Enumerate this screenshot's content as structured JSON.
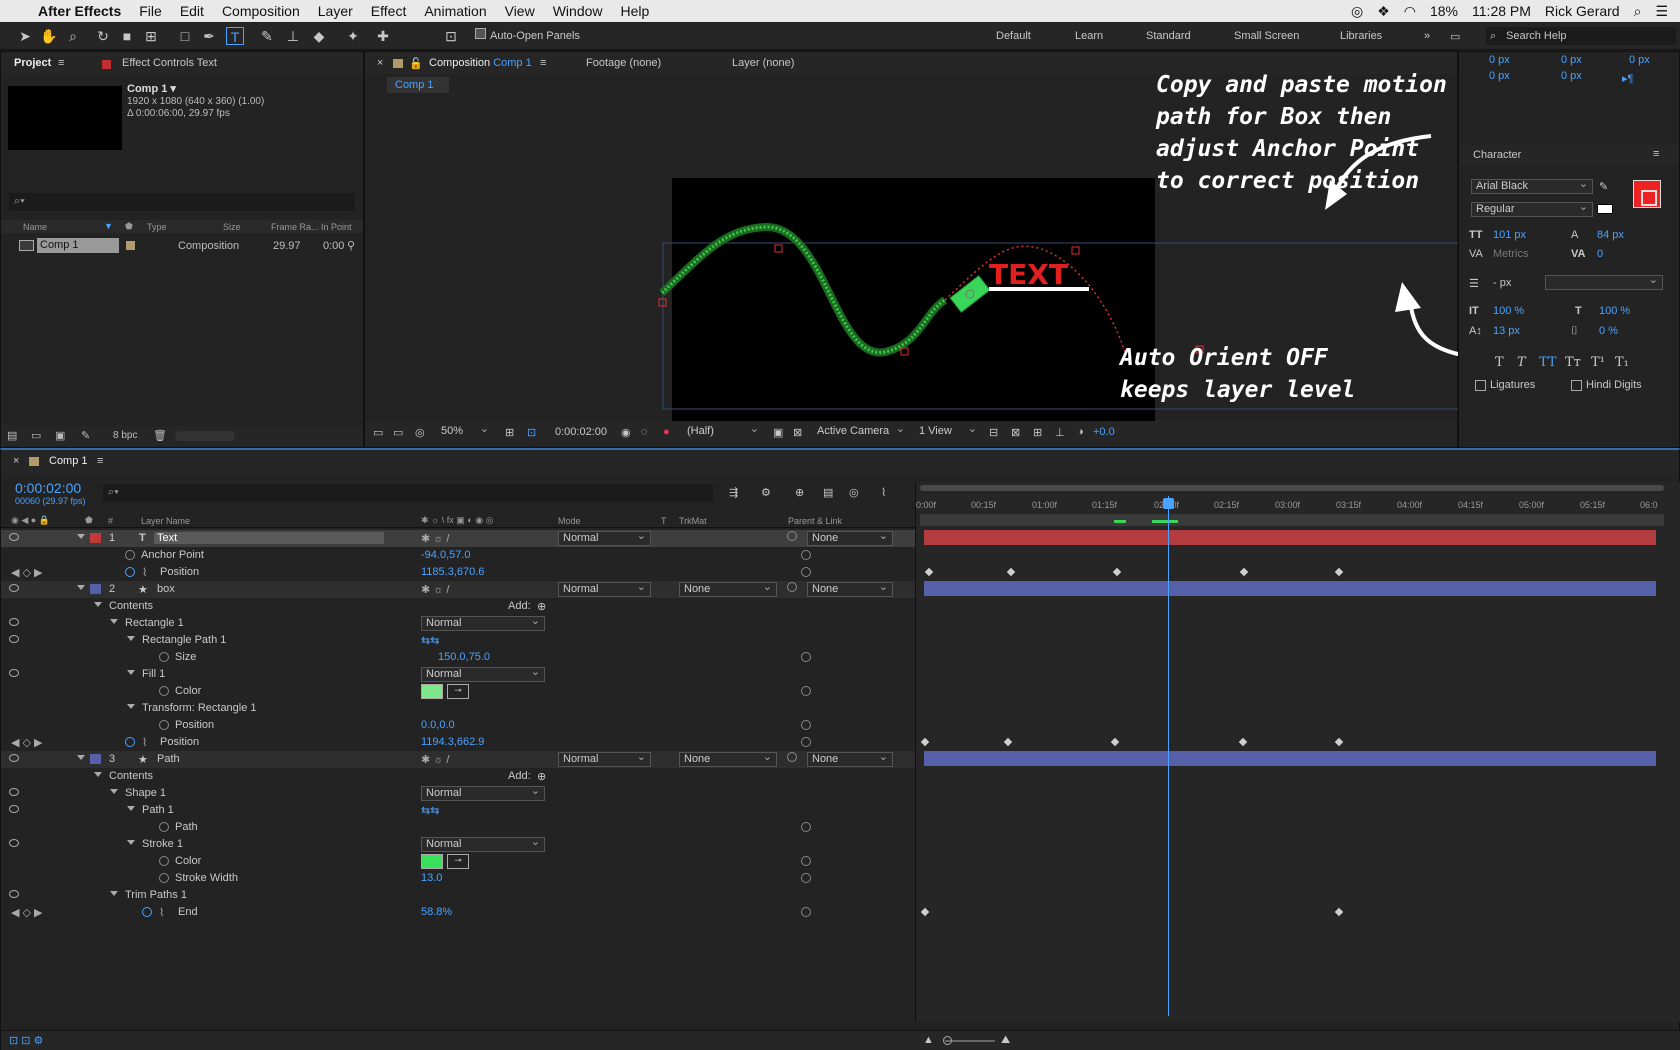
{
  "menubar": {
    "app": "After Effects",
    "items": [
      "File",
      "Edit",
      "Composition",
      "Layer",
      "Effect",
      "Animation",
      "View",
      "Window",
      "Help"
    ],
    "battery": "18%",
    "time": "11:28 PM",
    "user": "Rick Gerard"
  },
  "toolbar": {
    "auto_open": "Auto-Open Panels",
    "workspaces": [
      "Default",
      "Learn",
      "Standard",
      "Small Screen",
      "Libraries"
    ],
    "search": "Search Help"
  },
  "project": {
    "tab": "Project",
    "tab2": "Effect Controls Text",
    "comp_name": "Comp 1 ▾",
    "comp_info1": "1920 x 1080  (640 x 360) (1.00)",
    "comp_info2": "Δ 0:00:06:00, 29.97 fps",
    "cols": [
      "Name",
      "Type",
      "Size",
      "Frame Ra...",
      "In Point"
    ],
    "item": {
      "name": "Comp 1",
      "type": "Composition",
      "fps": "29.97",
      "in": "0:00"
    },
    "bpc": "8 bpc"
  },
  "viewer": {
    "tab_prefix": "Composition",
    "tab_comp": "Comp 1",
    "footage": "Footage (none)",
    "layer": "Layer (none)",
    "crumb": "Comp 1",
    "zoom": "50%",
    "time": "0:00:02:00",
    "res": "(Half)",
    "camera": "Active Camera",
    "view": "1 View",
    "exposure": "+0.0",
    "text_obj": "TEXT"
  },
  "annotations": {
    "top": "Copy and paste motion\npath for Box then\nadjust Anchor Point\nto correct position",
    "bottom": "Auto Orient OFF\nkeeps layer level"
  },
  "character": {
    "title": "Character",
    "font": "Arial Black",
    "style": "Regular",
    "size": "101 px",
    "leading": "84 px",
    "kerning": "Metrics",
    "tracking": "0",
    "stroke": "- px",
    "vscale": "100 %",
    "hscale": "100 %",
    "baseline": "13 px",
    "tsume": "0 %",
    "ligatures": "Ligatures",
    "hindi": "Hindi Digits",
    "top_vals": [
      "0 px",
      "0 px",
      "0 px",
      "0 px",
      "0 px"
    ],
    "fill_color": "#ee2222"
  },
  "timeline": {
    "tab": "Comp 1",
    "time": "0:00:02:00",
    "frames": "00060 (29.97 fps)",
    "hdr_layer": "Layer Name",
    "hdr_mode": "Mode",
    "hdr_t": "T",
    "hdr_trk": "TrkMat",
    "hdr_parent": "Parent & Link",
    "hdr_num": "#",
    "ruler": [
      "0:00f",
      "00:15f",
      "01:00f",
      "01:15f",
      "02:00f",
      "02:15f",
      "03:00f",
      "03:15f",
      "04:00f",
      "04:15f",
      "05:00f",
      "05:15f",
      "06:0"
    ],
    "rows": [
      {
        "n": "1",
        "name": "Text",
        "mode": "Normal",
        "parent": "None"
      },
      {
        "name": "Anchor Point",
        "val": "-94.0,57.0"
      },
      {
        "name": "Position",
        "val": "1185.3,670.6"
      },
      {
        "n": "2",
        "name": "box",
        "mode": "Normal",
        "trk": "None",
        "parent": "None"
      },
      {
        "name": "Contents",
        "add": "Add:"
      },
      {
        "name": "Rectangle 1",
        "mode": "Normal"
      },
      {
        "name": "Rectangle Path 1"
      },
      {
        "name": "Size",
        "val": "150.0,75.0"
      },
      {
        "name": "Fill 1",
        "mode": "Normal"
      },
      {
        "name": "Color"
      },
      {
        "name": "Transform: Rectangle 1"
      },
      {
        "name": "Position",
        "val": "0.0,0.0"
      },
      {
        "name": "Position",
        "val": "1194.3,662.9"
      },
      {
        "n": "3",
        "name": "Path",
        "mode": "Normal",
        "trk": "None",
        "parent": "None"
      },
      {
        "name": "Contents",
        "add": "Add:"
      },
      {
        "name": "Shape 1",
        "mode": "Normal"
      },
      {
        "name": "Path 1"
      },
      {
        "name": "Path"
      },
      {
        "name": "Stroke 1",
        "mode": "Normal"
      },
      {
        "name": "Color"
      },
      {
        "name": "Stroke Width",
        "val": "13.0"
      },
      {
        "name": "Trim Paths 1"
      },
      {
        "name": "End",
        "val": "58.8%"
      }
    ]
  },
  "colors": {
    "accent": "#4aa3ff",
    "text_layer": "#c0393b",
    "shape_layer": "#5560a8",
    "green": "#39d65a",
    "path_green": "#3fc74e",
    "fill_red": "#ee2222"
  }
}
